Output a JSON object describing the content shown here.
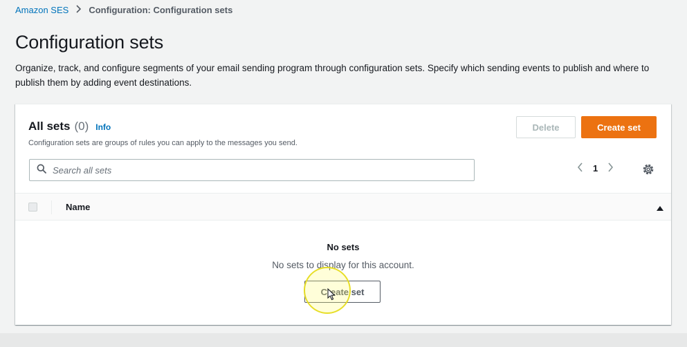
{
  "breadcrumb": {
    "root": "Amazon SES",
    "current": "Configuration: Configuration sets"
  },
  "page": {
    "title": "Configuration sets",
    "description": "Organize, track, and configure segments of your email sending program through configuration sets. Specify which sending events to publish and where to publish them by adding event destinations."
  },
  "panel": {
    "title": "All sets",
    "count": "(0)",
    "info_link": "Info",
    "subtitle": "Configuration sets are groups of rules you can apply to the messages you send.",
    "delete_label": "Delete",
    "create_label": "Create set"
  },
  "search": {
    "placeholder": "Search all sets",
    "value": ""
  },
  "pagination": {
    "current_page": "1"
  },
  "table": {
    "columns": [
      "Name"
    ],
    "sort": "ascending"
  },
  "empty_state": {
    "title": "No sets",
    "description": "No sets to display for this account.",
    "button_label": "Create set"
  },
  "icons": {
    "breadcrumb_separator": "chevron-right-icon",
    "search": "search-icon",
    "prev_page": "chevron-left-icon",
    "next_page": "chevron-right-icon",
    "settings": "gear-icon",
    "sort": "caret-up-icon"
  },
  "colors": {
    "link": "#0073bb",
    "primary_button": "#ec7211",
    "background": "#f2f3f3",
    "cursor_highlight": "#f0e632"
  }
}
